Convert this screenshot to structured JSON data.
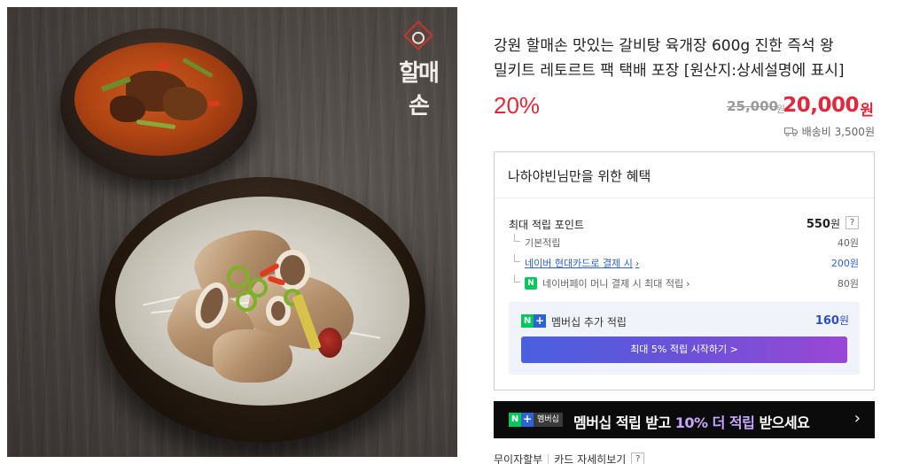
{
  "product": {
    "title": "강원 할매손 맛있는 갈비탕 육개장 600g 진한 즉석 왕 밀키트 레토르트 팩 택배 포장 [원산지:상세설명에 표시]",
    "brand_mark": "할매손",
    "discount_rate": "20%",
    "original_price": "25,000",
    "original_price_unit": "원",
    "sale_price": "20,000",
    "sale_price_unit": "원",
    "shipping_fee": "배송비 3,500원",
    "shipping_icon": "truck-icon"
  },
  "benefits": {
    "header": "나하야빈님만을 위한 혜택",
    "max_points_label": "최대 적립 포인트",
    "max_points_value": "550",
    "max_points_unit": "원",
    "help_icon": "?",
    "rows": [
      {
        "label": "기본적립",
        "value": "40원"
      },
      {
        "label": "네이버 현대카드로 결제 시",
        "value": "200원"
      },
      {
        "label": "네이버페이 머니 결제 시 최대 적립",
        "value": "80원"
      }
    ],
    "membership": {
      "badge_n": "N",
      "badge_plus": "+",
      "label": "멤버십 추가 적립",
      "points": "160",
      "points_unit": "원",
      "cta": "최대 5% 적립 시작하기 >"
    }
  },
  "promo_banner": {
    "badge_n": "N",
    "badge_plus": "+",
    "badge_word": "멤버십",
    "text_before": "멤버십 적립 받고 ",
    "text_highlight": "10% 더 적립",
    "text_after": " 받으세요",
    "arrow": "›"
  },
  "bottom_links": {
    "installment": "무이자할부",
    "card_details": "카드 자세히보기",
    "help": "?"
  },
  "colors": {
    "sale_red": "#e0293c",
    "link_blue": "#2e63d2",
    "naver_green": "#03c75a",
    "cta_gradient_start": "#4b5fe0",
    "cta_gradient_end": "#9a48d4"
  }
}
